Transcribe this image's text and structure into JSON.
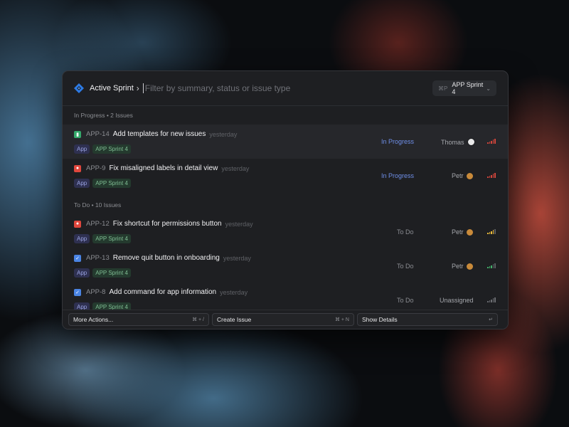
{
  "header": {
    "breadcrumb": "Active Sprint",
    "search_placeholder": "Filter by summary, status or issue type",
    "sprint_shortcut": "⌘P",
    "sprint_value": "APP Sprint 4"
  },
  "sections": [
    {
      "title": "In Progress • 2 Issues",
      "issues": [
        {
          "type": "story",
          "key": "APP-14",
          "summary": "Add templates for new issues",
          "time": "yesterday",
          "tags": [
            "App",
            "APP Sprint 4"
          ],
          "status": "In Progress",
          "assignee": "Thomas",
          "avatar": "thomas",
          "priority_colors": [
            "#d0453b",
            "#d0453b",
            "#d0453b",
            "#d0453b",
            "#d0453b"
          ],
          "selected": true
        },
        {
          "type": "bug",
          "key": "APP-9",
          "summary": "Fix misaligned labels in detail view",
          "time": "yesterday",
          "tags": [
            "App",
            "APP Sprint 4"
          ],
          "status": "In Progress",
          "assignee": "Petr",
          "avatar": "petr",
          "priority_colors": [
            "#d0453b",
            "#d0453b",
            "#d0453b",
            "#d0453b",
            "#d0453b"
          ],
          "selected": false
        }
      ]
    },
    {
      "title": "To Do • 10 Issues",
      "issues": [
        {
          "type": "bug",
          "key": "APP-12",
          "summary": "Fix shortcut for permissions button",
          "time": "yesterday",
          "tags": [
            "App",
            "APP Sprint 4"
          ],
          "status": "To Do",
          "assignee": "Petr",
          "avatar": "petr",
          "priority_colors": [
            "#e8b93b",
            "#e8b93b",
            "#e8b93b",
            "#e8b93b",
            "#5a5c61"
          ],
          "selected": false
        },
        {
          "type": "task",
          "key": "APP-13",
          "summary": "Remove quit button in onboarding",
          "time": "yesterday",
          "tags": [
            "App",
            "APP Sprint 4"
          ],
          "status": "To Do",
          "assignee": "Petr",
          "avatar": "petr",
          "priority_colors": [
            "#43b06a",
            "#43b06a",
            "#43b06a",
            "#5a5c61",
            "#5a5c61"
          ],
          "selected": false
        },
        {
          "type": "task",
          "key": "APP-8",
          "summary": "Add command for app information",
          "time": "yesterday",
          "tags": [
            "App",
            "APP Sprint 4"
          ],
          "status": "To Do",
          "assignee": "Unassigned",
          "avatar": "",
          "priority_colors": [
            "#6a6c71",
            "#6a6c71",
            "#6a6c71",
            "#6a6c71",
            "#6a6c71"
          ],
          "selected": false
        }
      ]
    }
  ],
  "footer": {
    "more_actions": "More Actions...",
    "more_actions_kbd": "⌘ + /",
    "create_issue": "Create Issue",
    "create_issue_kbd": "⌘ + N",
    "show_details": "Show Details",
    "show_details_kbd": "↵"
  },
  "colors": {
    "accent_blue": "#2d7be5",
    "status_in_progress": "#6f8fe8"
  }
}
